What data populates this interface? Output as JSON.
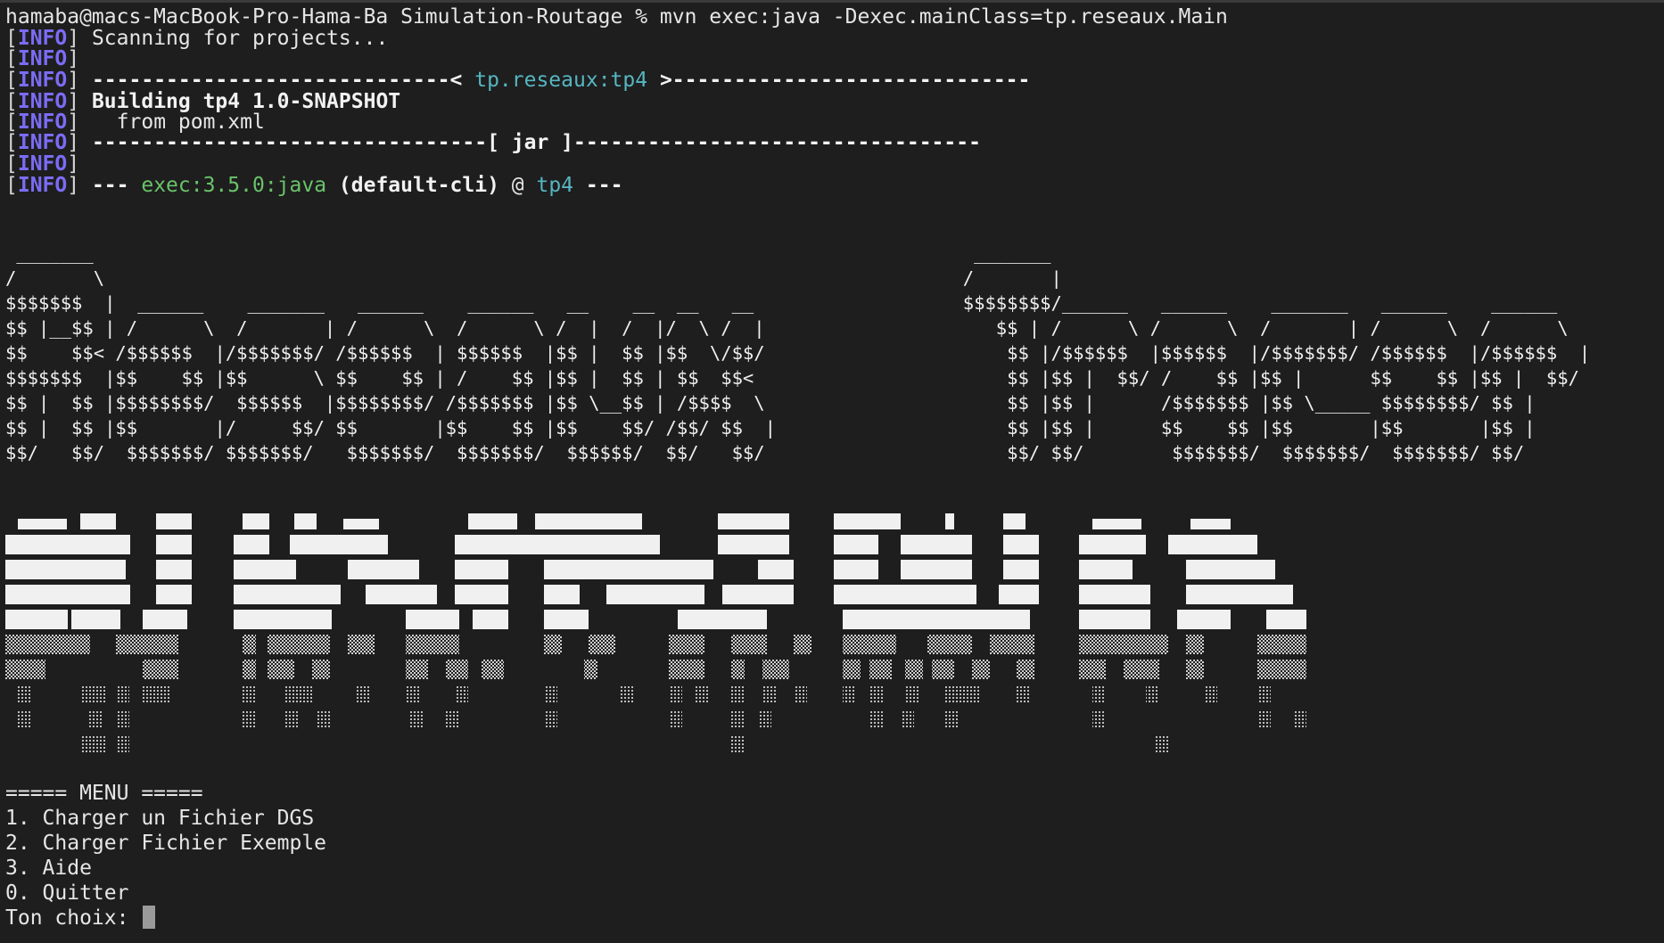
{
  "prompt_line": "hamaba@macs-MacBook-Pro-Hama-Ba Simulation-Routage % mvn exec:java -Dexec.mainClass=tp.reseaux.Main",
  "info_tag": "INFO",
  "log": {
    "l1": "Scanning for projects...",
    "l3_left": "-----------------------------< ",
    "l3_artifact": "tp.reseaux:tp4",
    "l3_right": " >-----------------------------",
    "l4": "Building tp4 1.0-SNAPSHOT",
    "l5": "  from pom.xml",
    "l6": "--------------------------------[ jar ]---------------------------------",
    "l8_dash": "--- ",
    "l8_plugin": "exec:3.5.0:java",
    "l8_exec": " (default-cli)",
    "l8_at": " @ ",
    "l8_project": "tp4",
    "l8_end": " ---"
  },
  "banner": " _______                                                                                _______\n/       \\                                                                              /       |\n$$$$$$$  |  ______    _______   ______    ______   __    __  __   __                   $$$$$$$$/______   ______    _______   ______    ______\n$$ |__$$ | /      \\  /       | /      \\  /      \\ /  |  /  |/  \\ /  |                     $$ | /      \\ /      \\  /       | /      \\  /      \\\n$$    $$< /$$$$$$  |/$$$$$$$/ /$$$$$$  | $$$$$$  |$$ |  $$ |$$  \\/$$/                      $$ |/$$$$$$  |$$$$$$  |/$$$$$$$/ /$$$$$$  |/$$$$$$  |\n$$$$$$$  |$$    $$ |$$      \\ $$    $$ | /    $$ |$$ |  $$ | $$  $$<                       $$ |$$ |  $$/ /    $$ |$$ |      $$    $$ |$$ |  $$/\n$$ |  $$ |$$$$$$$$/  $$$$$$  |$$$$$$$$/ /$$$$$$$ |$$ \\__$$ | /$$$$  \\                      $$ |$$ |      /$$$$$$$ |$$ \\_____ $$$$$$$$/ $$ |\n$$ |  $$ |$$       |/     $$/ $$       |$$    $$ |$$    $$/ /$$/ $$  |                     $$ |$$ |      $$    $$ |$$       |$$       |$$ |\n$$/   $$/  $$$$$$$/ $$$$$$$/   $$$$$$$/  $$$$$$$/  $$$$$$/  $$/   $$/                      $$/ $$/        $$$$$$$/  $$$$$$$/  $$$$$$$/ $$/",
  "menu": {
    "title": "===== MENU =====",
    "items": [
      "1. Charger un Fichier DGS",
      "2. Charger Fichier Exemple",
      "3. Aide",
      "0. Quitter"
    ],
    "prompt": "Ton choix: "
  },
  "colors": {
    "background": "#1e1e1e",
    "info": "#7b6cf6",
    "artifact_cyan": "#56b6c2",
    "plugin_green": "#6ac36a"
  }
}
